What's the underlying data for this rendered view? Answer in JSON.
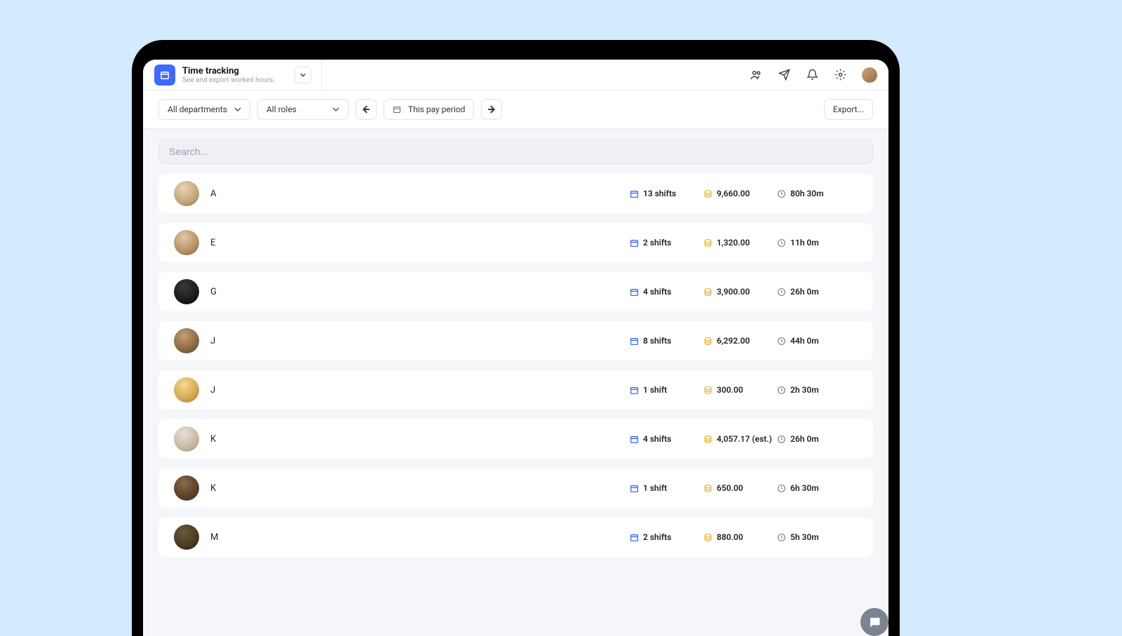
{
  "header": {
    "title": "Time tracking",
    "subtitle": "See and export worked hours."
  },
  "toolbar": {
    "departments": "All departments",
    "roles": "All roles",
    "period": "This pay period",
    "export": "Export..."
  },
  "search": {
    "placeholder": "Search..."
  },
  "rows": [
    {
      "name": "A",
      "shifts": "13 shifts",
      "cost": "9,660.00",
      "time": "80h 30m",
      "av": "av1"
    },
    {
      "name": "E",
      "shifts": "2 shifts",
      "cost": "1,320.00",
      "time": "11h 0m",
      "av": "av2"
    },
    {
      "name": "G",
      "shifts": "4 shifts",
      "cost": "3,900.00",
      "time": "26h 0m",
      "av": "av3"
    },
    {
      "name": "J",
      "shifts": "8 shifts",
      "cost": "6,292.00",
      "time": "44h 0m",
      "av": "av4"
    },
    {
      "name": "J",
      "shifts": "1 shift",
      "cost": "300.00",
      "time": "2h 30m",
      "av": "av5"
    },
    {
      "name": "K",
      "shifts": "4 shifts",
      "cost": "4,057.17 (est.)",
      "time": "26h 0m",
      "av": "av6"
    },
    {
      "name": "K",
      "shifts": "1 shift",
      "cost": "650.00",
      "time": "6h 30m",
      "av": "av7"
    },
    {
      "name": "M",
      "shifts": "2 shifts",
      "cost": "880.00",
      "time": "5h 30m",
      "av": "av8"
    }
  ]
}
